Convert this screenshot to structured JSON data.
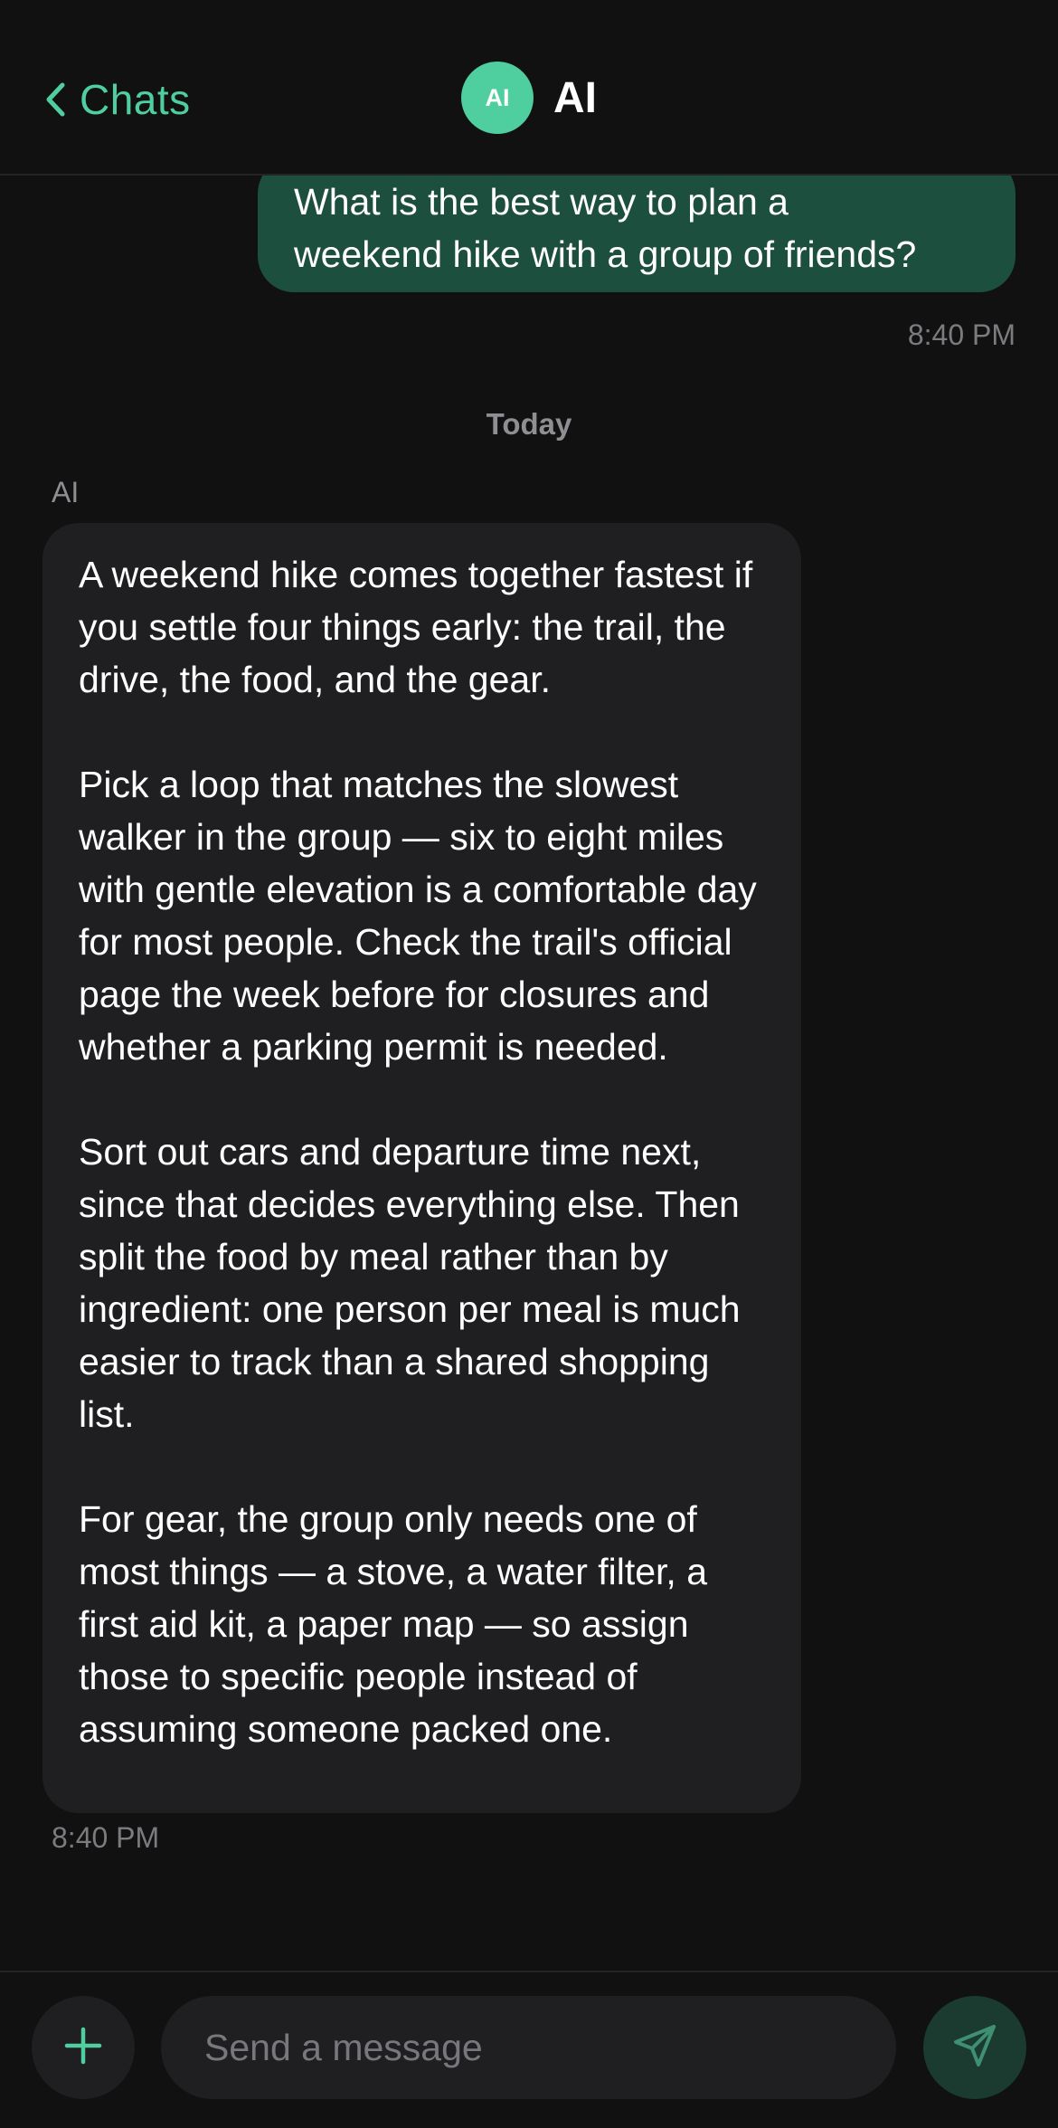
{
  "header": {
    "back_label": "Chats",
    "avatar_text": "AI",
    "title": "AI"
  },
  "colors": {
    "accent": "#4fcea0",
    "user_bubble": "#1d4f3f",
    "ai_bubble": "#1f1f21",
    "background": "#111112"
  },
  "messages": {
    "user": {
      "lines": [
        "What is the best way to plan a",
        "weekend hike with a group of friends?"
      ],
      "time": "8:40 PM"
    },
    "date_separator": "Today",
    "ai": {
      "sender": "AI",
      "paragraphs": [
        "A weekend hike comes together fastest if you settle four things early: the trail, the drive, the food, and the gear.",
        "Pick a loop that matches the slowest walker in the group — six to eight miles with gentle elevation is a comfortable day for most people. Check the trail's official page the week before for closures and whether a parking permit is needed.",
        "Sort out cars and departure time next, since that decides everything else. Then split the food by meal rather than by ingredient: one person per meal is much easier to track than a shared shopping list.",
        "For gear, the group only needs one of most things — a stove, a water filter, a first aid kit, a paper map — so assign those to specific people instead of assuming someone packed one."
      ],
      "time": "8:40 PM"
    }
  },
  "composer": {
    "placeholder": "Send a message",
    "value": "",
    "add_icon": "plus-icon",
    "send_icon": "send-icon"
  }
}
